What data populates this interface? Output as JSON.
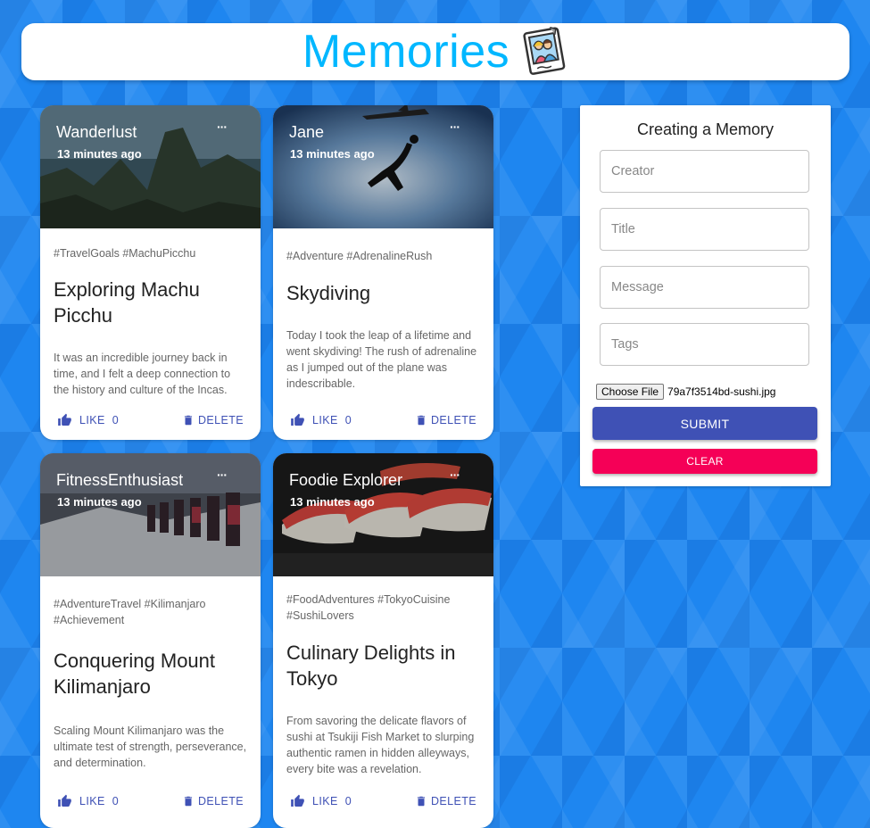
{
  "app": {
    "title": "Memories",
    "icon": "photo-memories-icon",
    "accent": "#00b7ff"
  },
  "posts": [
    {
      "creator": "Wanderlust",
      "time": "13 minutes ago",
      "more": "···",
      "tags": "#TravelGoals #MachuPicchu",
      "title": "Exploring Machu Picchu",
      "message": "It was an incredible journey back in time, and I felt a deep connection to the history and culture of the Incas.",
      "like_label": "LIKE",
      "like_count": "0",
      "delete_label": "DELETE",
      "image": "mountain-photo"
    },
    {
      "creator": "Jane",
      "time": "13 minutes ago",
      "more": "···",
      "tags": "#Adventure #AdrenalineRush",
      "title": "Skydiving",
      "message": "Today I took the leap of a lifetime and went skydiving! The rush of adrenaline as I jumped out of the plane was indescribable.",
      "like_label": "LIKE",
      "like_count": "0",
      "delete_label": "DELETE",
      "image": "skydiver-photo"
    },
    {
      "creator": "FitnessEnthusiast",
      "time": "13 minutes ago",
      "more": "···",
      "tags": "#AdventureTravel #Kilimanjaro #Achievement",
      "title": "Conquering Mount Kilimanjaro",
      "message": "Scaling Mount Kilimanjaro was the ultimate test of strength, perseverance, and determination.",
      "like_label": "LIKE",
      "like_count": "0",
      "delete_label": "DELETE",
      "image": "hikers-photo"
    },
    {
      "creator": "Foodie Explorer",
      "time": "13 minutes ago",
      "more": "···",
      "tags": "#FoodAdventures #TokyoCuisine #SushiLovers",
      "title": "Culinary Delights in Tokyo",
      "message": "From savoring the delicate flavors of sushi at Tsukiji Fish Market to slurping authentic ramen in hidden alleyways, every bite was a revelation.",
      "like_label": "LIKE",
      "like_count": "0",
      "delete_label": "DELETE",
      "image": "sushi-photo"
    }
  ],
  "form": {
    "title": "Creating a Memory",
    "creator_placeholder": "Creator",
    "title_placeholder": "Title",
    "message_placeholder": "Message",
    "tags_placeholder": "Tags",
    "file_button": "Choose File",
    "file_name": "79a7f3514bd-sushi.jpg",
    "submit_label": "SUBMIT",
    "clear_label": "CLEAR"
  },
  "colors": {
    "background": "#1e86f0",
    "primary": "#3f51b5",
    "secondary": "#f50057"
  }
}
